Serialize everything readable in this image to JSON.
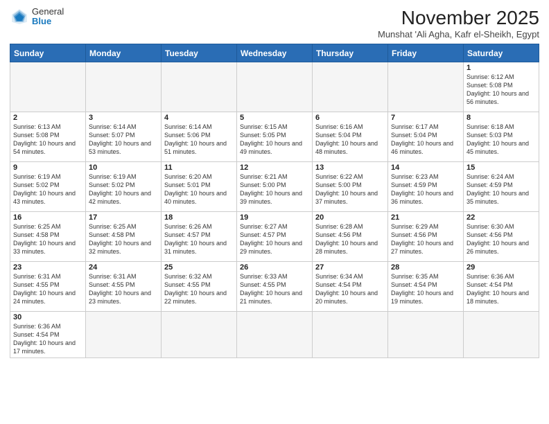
{
  "logo": {
    "general": "General",
    "blue": "Blue"
  },
  "title": "November 2025",
  "subtitle": "Munshat 'Ali Agha, Kafr el-Sheikh, Egypt",
  "days_header": [
    "Sunday",
    "Monday",
    "Tuesday",
    "Wednesday",
    "Thursday",
    "Friday",
    "Saturday"
  ],
  "weeks": [
    [
      {
        "day": "",
        "info": ""
      },
      {
        "day": "",
        "info": ""
      },
      {
        "day": "",
        "info": ""
      },
      {
        "day": "",
        "info": ""
      },
      {
        "day": "",
        "info": ""
      },
      {
        "day": "",
        "info": ""
      },
      {
        "day": "1",
        "info": "Sunrise: 6:12 AM\nSunset: 5:08 PM\nDaylight: 10 hours and 56 minutes."
      }
    ],
    [
      {
        "day": "2",
        "info": "Sunrise: 6:13 AM\nSunset: 5:08 PM\nDaylight: 10 hours and 54 minutes."
      },
      {
        "day": "3",
        "info": "Sunrise: 6:14 AM\nSunset: 5:07 PM\nDaylight: 10 hours and 53 minutes."
      },
      {
        "day": "4",
        "info": "Sunrise: 6:14 AM\nSunset: 5:06 PM\nDaylight: 10 hours and 51 minutes."
      },
      {
        "day": "5",
        "info": "Sunrise: 6:15 AM\nSunset: 5:05 PM\nDaylight: 10 hours and 49 minutes."
      },
      {
        "day": "6",
        "info": "Sunrise: 6:16 AM\nSunset: 5:04 PM\nDaylight: 10 hours and 48 minutes."
      },
      {
        "day": "7",
        "info": "Sunrise: 6:17 AM\nSunset: 5:04 PM\nDaylight: 10 hours and 46 minutes."
      },
      {
        "day": "8",
        "info": "Sunrise: 6:18 AM\nSunset: 5:03 PM\nDaylight: 10 hours and 45 minutes."
      }
    ],
    [
      {
        "day": "9",
        "info": "Sunrise: 6:19 AM\nSunset: 5:02 PM\nDaylight: 10 hours and 43 minutes."
      },
      {
        "day": "10",
        "info": "Sunrise: 6:19 AM\nSunset: 5:02 PM\nDaylight: 10 hours and 42 minutes."
      },
      {
        "day": "11",
        "info": "Sunrise: 6:20 AM\nSunset: 5:01 PM\nDaylight: 10 hours and 40 minutes."
      },
      {
        "day": "12",
        "info": "Sunrise: 6:21 AM\nSunset: 5:00 PM\nDaylight: 10 hours and 39 minutes."
      },
      {
        "day": "13",
        "info": "Sunrise: 6:22 AM\nSunset: 5:00 PM\nDaylight: 10 hours and 37 minutes."
      },
      {
        "day": "14",
        "info": "Sunrise: 6:23 AM\nSunset: 4:59 PM\nDaylight: 10 hours and 36 minutes."
      },
      {
        "day": "15",
        "info": "Sunrise: 6:24 AM\nSunset: 4:59 PM\nDaylight: 10 hours and 35 minutes."
      }
    ],
    [
      {
        "day": "16",
        "info": "Sunrise: 6:25 AM\nSunset: 4:58 PM\nDaylight: 10 hours and 33 minutes."
      },
      {
        "day": "17",
        "info": "Sunrise: 6:25 AM\nSunset: 4:58 PM\nDaylight: 10 hours and 32 minutes."
      },
      {
        "day": "18",
        "info": "Sunrise: 6:26 AM\nSunset: 4:57 PM\nDaylight: 10 hours and 31 minutes."
      },
      {
        "day": "19",
        "info": "Sunrise: 6:27 AM\nSunset: 4:57 PM\nDaylight: 10 hours and 29 minutes."
      },
      {
        "day": "20",
        "info": "Sunrise: 6:28 AM\nSunset: 4:56 PM\nDaylight: 10 hours and 28 minutes."
      },
      {
        "day": "21",
        "info": "Sunrise: 6:29 AM\nSunset: 4:56 PM\nDaylight: 10 hours and 27 minutes."
      },
      {
        "day": "22",
        "info": "Sunrise: 6:30 AM\nSunset: 4:56 PM\nDaylight: 10 hours and 26 minutes."
      }
    ],
    [
      {
        "day": "23",
        "info": "Sunrise: 6:31 AM\nSunset: 4:55 PM\nDaylight: 10 hours and 24 minutes."
      },
      {
        "day": "24",
        "info": "Sunrise: 6:31 AM\nSunset: 4:55 PM\nDaylight: 10 hours and 23 minutes."
      },
      {
        "day": "25",
        "info": "Sunrise: 6:32 AM\nSunset: 4:55 PM\nDaylight: 10 hours and 22 minutes."
      },
      {
        "day": "26",
        "info": "Sunrise: 6:33 AM\nSunset: 4:55 PM\nDaylight: 10 hours and 21 minutes."
      },
      {
        "day": "27",
        "info": "Sunrise: 6:34 AM\nSunset: 4:54 PM\nDaylight: 10 hours and 20 minutes."
      },
      {
        "day": "28",
        "info": "Sunrise: 6:35 AM\nSunset: 4:54 PM\nDaylight: 10 hours and 19 minutes."
      },
      {
        "day": "29",
        "info": "Sunrise: 6:36 AM\nSunset: 4:54 PM\nDaylight: 10 hours and 18 minutes."
      }
    ],
    [
      {
        "day": "30",
        "info": "Sunrise: 6:36 AM\nSunset: 4:54 PM\nDaylight: 10 hours and 17 minutes."
      },
      {
        "day": "",
        "info": ""
      },
      {
        "day": "",
        "info": ""
      },
      {
        "day": "",
        "info": ""
      },
      {
        "day": "",
        "info": ""
      },
      {
        "day": "",
        "info": ""
      },
      {
        "day": "",
        "info": ""
      }
    ]
  ]
}
